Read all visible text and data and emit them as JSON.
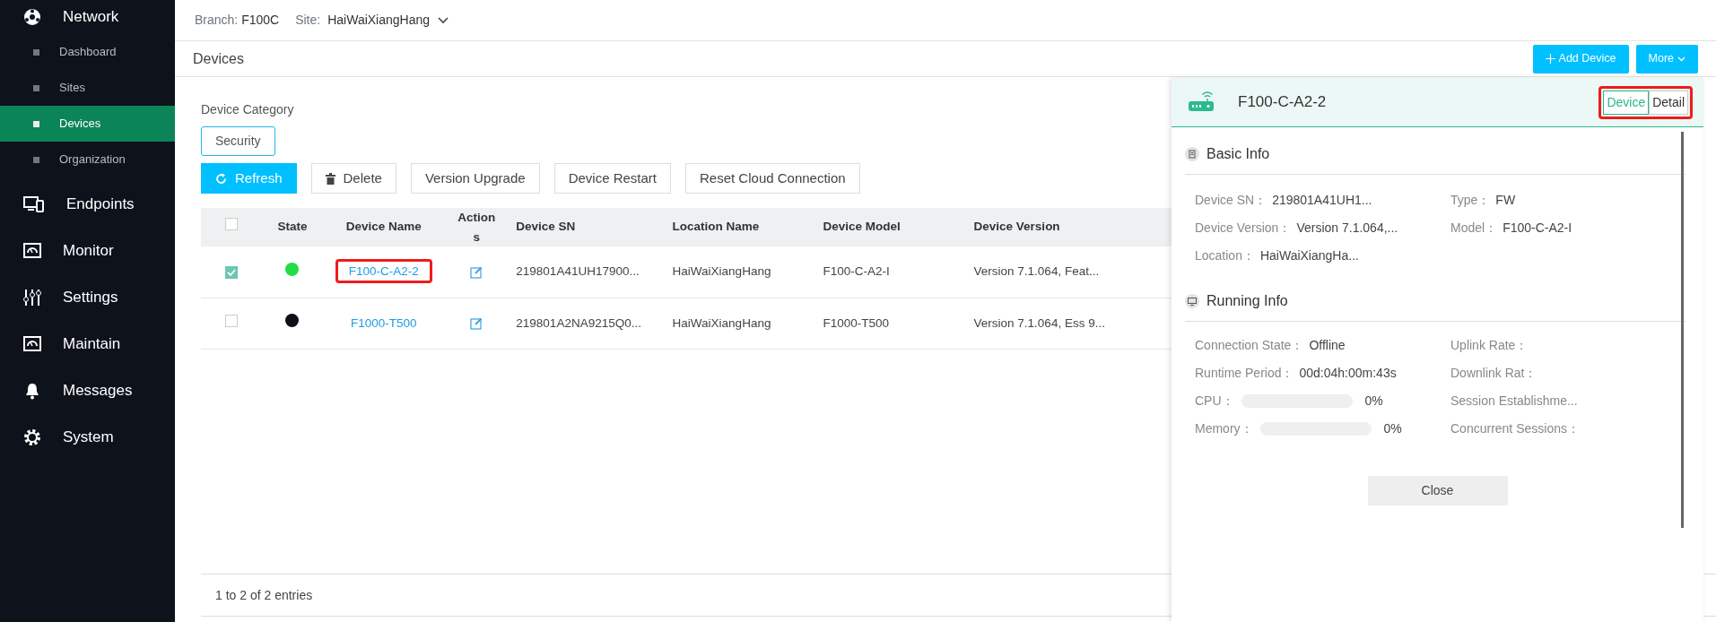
{
  "sidebar": {
    "groups": [
      {
        "label": "Network",
        "children": [
          {
            "label": "Dashboard",
            "selected": false
          },
          {
            "label": "Sites",
            "selected": false
          },
          {
            "label": "Devices",
            "selected": true
          },
          {
            "label": "Organization",
            "selected": false
          }
        ]
      },
      {
        "label": "Endpoints"
      },
      {
        "label": "Monitor"
      },
      {
        "label": "Settings"
      },
      {
        "label": "Maintain"
      },
      {
        "label": "Messages"
      },
      {
        "label": "System"
      }
    ]
  },
  "header": {
    "branch_label": "Branch:",
    "branch": "F100C",
    "site_label": "Site:",
    "site": "HaiWaiXiangHang"
  },
  "page_title": "Devices",
  "page_buttons": [
    {
      "label": "Add Device"
    },
    {
      "label": "More"
    }
  ],
  "category": {
    "label": "Device Category",
    "options": [
      {
        "label": "Security",
        "selected": true
      }
    ]
  },
  "toolbar": [
    {
      "label": "Refresh",
      "kind": "primary"
    },
    {
      "label": "Delete",
      "kind": "default"
    },
    {
      "label": "Version Upgrade",
      "kind": "default"
    },
    {
      "label": "Device Restart",
      "kind": "default"
    },
    {
      "label": "Reset Cloud Connection",
      "kind": "default"
    }
  ],
  "table": {
    "all_checked": false,
    "columns": [
      "State",
      "Device Name",
      "Actions",
      "Device SN",
      "Location Name",
      "Device Model",
      "Device Version"
    ],
    "rows": [
      {
        "checked": true,
        "color": "#22dd44",
        "name": "F100-C-A2-2",
        "highlighted": true,
        "sn": "219801A41UH17900...",
        "location": "HaiWaiXiangHang",
        "model": "F100-C-A2-I",
        "version": "Version 7.1.064, Feat..."
      },
      {
        "checked": false,
        "color": "#0d1117",
        "name": "F1000-T500",
        "highlighted": false,
        "sn": "219801A2NA9215Q0...",
        "location": "HaiWaiXiangHang",
        "model": "F1000-T500",
        "version": "Version 7.1.064, Ess 9..."
      }
    ]
  },
  "footer": "1 to 2 of 2 entries",
  "panel": {
    "title": "F100-C-A2-2",
    "tabs_highlighted": true,
    "tabs": [
      {
        "label": "Device",
        "selected": true
      },
      {
        "label": "Detail",
        "selected": false
      }
    ],
    "sections": [
      {
        "title": "Basic Info",
        "fields": [
          {
            "label": "Device SN：",
            "value": "219801A41UH1..."
          },
          {
            "label": "Type：",
            "value": "FW"
          },
          {
            "label": "Device Version：",
            "value": "Version 7.1.064,..."
          },
          {
            "label": "Model：",
            "value": "F100-C-A2-I"
          },
          {
            "label": "Location：",
            "value": "HaiWaiXiangHa..."
          }
        ]
      },
      {
        "title": "Running Info",
        "fields": [
          {
            "label": "Connection State：",
            "value": "Offline"
          },
          {
            "label": "Uplink Rate："
          },
          {
            "label": "Runtime Period：",
            "value": "00d:04h:00m:43s"
          },
          {
            "label": "Downlink Rat："
          },
          {
            "label": "CPU：",
            "kind": "meter",
            "level": 0,
            "reading": "0%"
          },
          {
            "label": "Session Establishme..."
          },
          {
            "label": "Memory：",
            "kind": "meter",
            "level": 0,
            "reading": "0%"
          },
          {
            "label": "Concurrent Sessions："
          }
        ]
      }
    ],
    "close": "Close"
  }
}
